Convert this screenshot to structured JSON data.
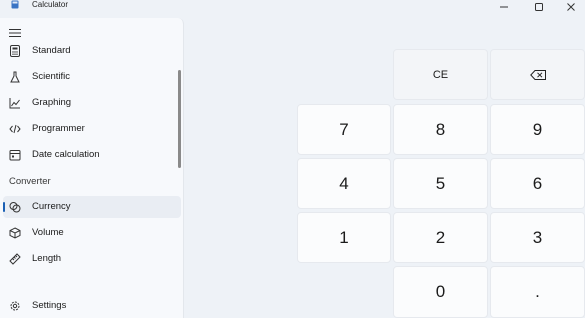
{
  "window": {
    "title": "Calculator",
    "controls": [
      "minimize-icon",
      "maximize-icon",
      "close-icon"
    ]
  },
  "sidebar": {
    "menu_icon": "hamburger-menu-icon",
    "items": [
      {
        "label": "Standard",
        "icon": "standard-calculator-icon"
      },
      {
        "label": "Scientific",
        "icon": "flask-icon"
      },
      {
        "label": "Graphing",
        "icon": "graph-icon"
      },
      {
        "label": "Programmer",
        "icon": "code-brackets-icon"
      },
      {
        "label": "Date calculation",
        "icon": "calendar-icon"
      }
    ],
    "section_converter": "Converter",
    "converter_items": [
      {
        "label": "Currency",
        "icon": "currency-icon",
        "selected": true
      },
      {
        "label": "Volume",
        "icon": "cube-icon"
      },
      {
        "label": "Length",
        "icon": "ruler-icon"
      }
    ],
    "settings": {
      "label": "Settings",
      "icon": "gear-icon"
    }
  },
  "keypad": {
    "ce": "CE",
    "backspace_icon": "backspace-icon",
    "digits": [
      "7",
      "8",
      "9",
      "4",
      "5",
      "6",
      "1",
      "2",
      "3",
      "0"
    ],
    "decimal": "."
  },
  "colors": {
    "accent": "#1a5fb4",
    "background": "#eef2f7",
    "sidebar": "#f7f9fc"
  }
}
